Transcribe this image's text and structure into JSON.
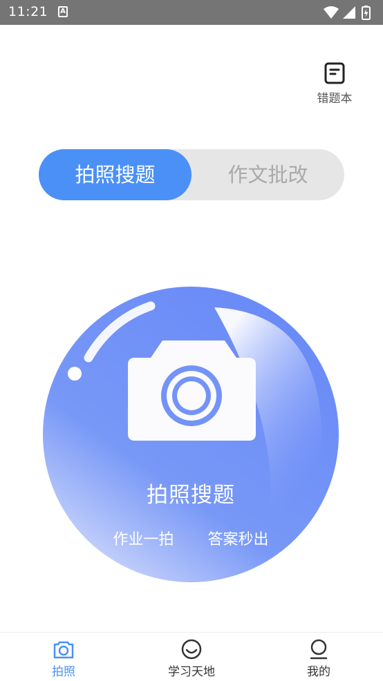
{
  "status_bar": {
    "time": "11:21",
    "badge": "A"
  },
  "top": {
    "mistake_book_label": "错题本"
  },
  "mode_switch": {
    "active_label": "拍照搜题",
    "inactive_label": "作文批改"
  },
  "camera_orb": {
    "title": "拍照搜题",
    "subtitle_left": "作业一拍",
    "subtitle_right": "答案秒出"
  },
  "bottom_nav": {
    "items": [
      {
        "label": "拍照",
        "icon": "camera-icon",
        "active": true
      },
      {
        "label": "学习天地",
        "icon": "smile-face-icon",
        "active": false
      },
      {
        "label": "我的",
        "icon": "person-icon",
        "active": false
      }
    ]
  },
  "colors": {
    "accent": "#4a90f7",
    "orb": "#6f8ff7",
    "status_bar": "#757575"
  }
}
